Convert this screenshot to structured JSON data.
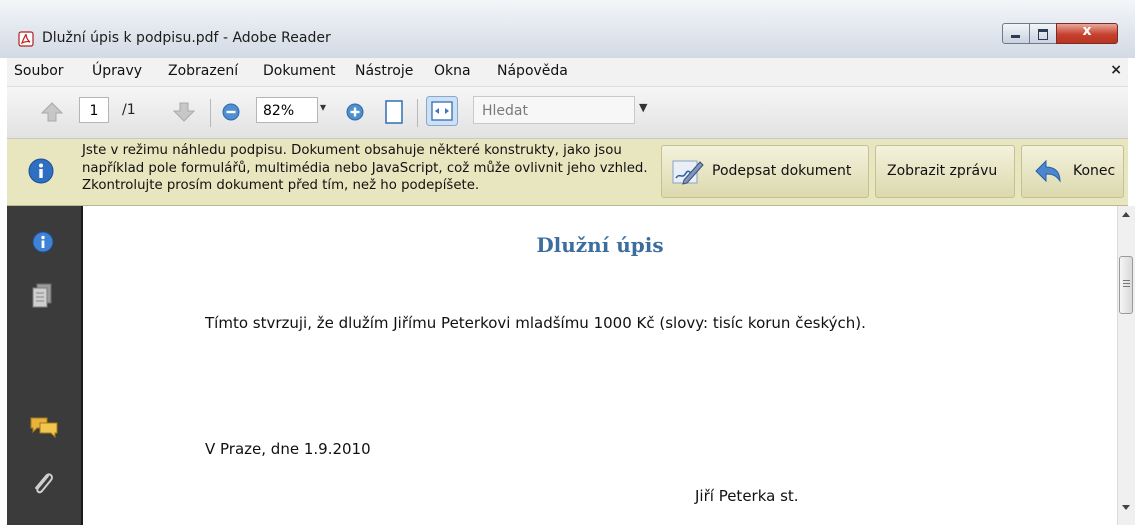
{
  "window": {
    "title": "Dlužní úpis k podpisu.pdf - Adobe Reader",
    "controls": {
      "minimize": "minimize",
      "maximize": "maximize",
      "close": "x"
    }
  },
  "menubar": {
    "items": [
      "Soubor",
      "Úpravy",
      "Zobrazení",
      "Dokument",
      "Nástroje",
      "Okna",
      "Nápověda"
    ],
    "close": "×"
  },
  "toolbar": {
    "page_current": "1",
    "page_total": "/1",
    "zoom": "82%",
    "search_placeholder": "Hledat",
    "icons": [
      "arrow-up-icon",
      "arrow-down-icon",
      "zoom-out-icon",
      "zoom-in-icon",
      "fit-page-icon",
      "fit-width-icon"
    ]
  },
  "notice": {
    "text": "Jste v režimu náhledu podpisu. Dokument obsahuje některé konstrukty, jako jsou například pole formulářů, multimédia nebo JavaScript, což může ovlivnit jeho vzhled. Zkontrolujte prosím dokument před tím, než ho podepíšete.",
    "sign_button": "Podepsat dokument",
    "report_button": "Zobrazit zprávu",
    "close_button": "Konec"
  },
  "nav_panel": {
    "icons": [
      "info-icon",
      "pages-icon",
      "comments-icon",
      "attachment-icon"
    ]
  },
  "document": {
    "title": "Dlužní úpis",
    "body": "Tímto stvrzuji, že dlužím Jiřímu Peterkovi mladšímu 1000 Kč (slovy: tisíc korun českých).",
    "place_date": "V Praze, dne 1.9.2010",
    "signer": "Jiří Peterka st."
  },
  "colors": {
    "notice_bg": "#e8e6bf",
    "nav_bg": "#3b3b3b",
    "doc_title": "#3b6e9f",
    "close_button": "#c6412f"
  }
}
